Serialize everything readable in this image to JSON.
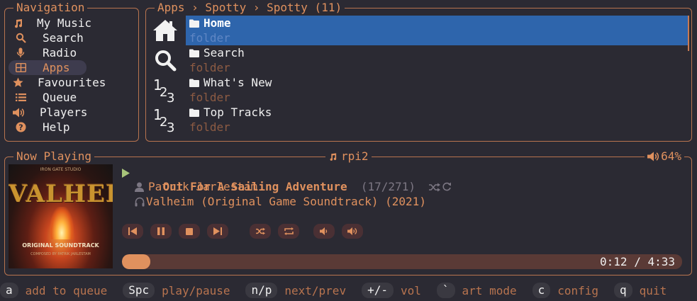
{
  "nav": {
    "title": "Navigation",
    "items": [
      {
        "label": "My Music",
        "icon": "music-note-icon"
      },
      {
        "label": "Search",
        "icon": "search-icon"
      },
      {
        "label": "Radio",
        "icon": "microphone-icon"
      },
      {
        "label": "Apps",
        "icon": "grid-icon",
        "active": true
      },
      {
        "label": "Favourites",
        "icon": "star-icon"
      },
      {
        "label": "Queue",
        "icon": "list-icon"
      },
      {
        "label": "Players",
        "icon": "speaker-icon"
      },
      {
        "label": "Help",
        "icon": "help-icon"
      }
    ]
  },
  "apps": {
    "breadcrumb": "Apps › Spotty › Spotty (11)",
    "items": [
      {
        "name": "Home",
        "type": "folder",
        "icon": "home-icon",
        "selected": true
      },
      {
        "name": "Search",
        "type": "folder",
        "icon": "search-icon"
      },
      {
        "name": "What's New",
        "type": "folder",
        "icon": "numbers-icon"
      },
      {
        "name": "Top Tracks",
        "type": "folder",
        "icon": "numbers-icon"
      }
    ]
  },
  "now_playing": {
    "title": "Now Playing",
    "player": "rpi2",
    "volume": "64%",
    "track_title": "Out For A Sailing Adventure",
    "track_position": "(17/271)",
    "artist": "Patrik Jarlestam",
    "album": "Valheim (Original Game Soundtrack) (2021)",
    "elapsed_total": "0:12 / 4:33",
    "progress": 0.045,
    "art": {
      "top_text": "IRON GATE STUDIO",
      "title_text": "VALHEIM",
      "subtitle_text": "ORIGINAL SOUNDTRACK",
      "bottom_text": "COMPOSED BY PATRIK JARLESTAM"
    }
  },
  "help": [
    {
      "key": "a",
      "desc": "add to queue"
    },
    {
      "key": "Spc",
      "desc": "play/pause"
    },
    {
      "key": "n/p",
      "desc": "next/prev"
    },
    {
      "key": "+/-",
      "desc": "vol"
    },
    {
      "key": "`",
      "desc": "art mode"
    },
    {
      "key": "c",
      "desc": "config"
    },
    {
      "key": "q",
      "desc": "quit"
    }
  ],
  "colors": {
    "background": "#2b2a33",
    "accent": "#e0915e",
    "selection": "#2e65ac",
    "muted": "#8d5b43"
  }
}
